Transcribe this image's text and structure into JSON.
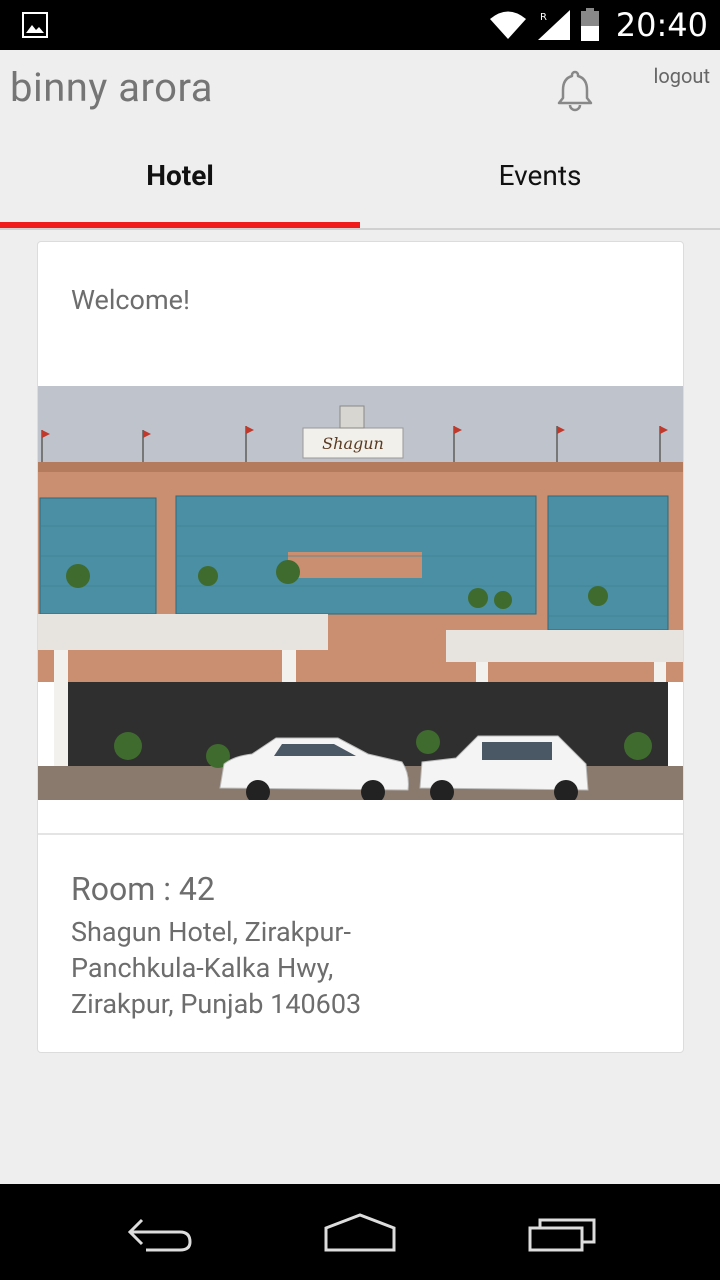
{
  "status_bar": {
    "time": "20:40",
    "icons": [
      "image-icon",
      "wifi-icon",
      "signal-icon",
      "battery-icon"
    ]
  },
  "header": {
    "user_name": "binny arora",
    "logout_label": "logout",
    "notification_icon": "bell-icon"
  },
  "tabs": [
    {
      "label": "Hotel",
      "active": true
    },
    {
      "label": "Events",
      "active": false
    }
  ],
  "card": {
    "welcome_text": "Welcome!",
    "photo_sign": "Shagun",
    "room_label": "Room :",
    "room_number": "42",
    "address": "Shagun Hotel, Zirakpur-Panchkula-Kalka Hwy, Zirakpur, Punjab 140603"
  },
  "nav_bar": {
    "icons": [
      "back-icon",
      "home-icon",
      "recents-icon"
    ]
  },
  "colors": {
    "accent": "#f01a1a",
    "background": "#eeeeee",
    "card": "#ffffff",
    "text_secondary": "#6d6d6d"
  }
}
